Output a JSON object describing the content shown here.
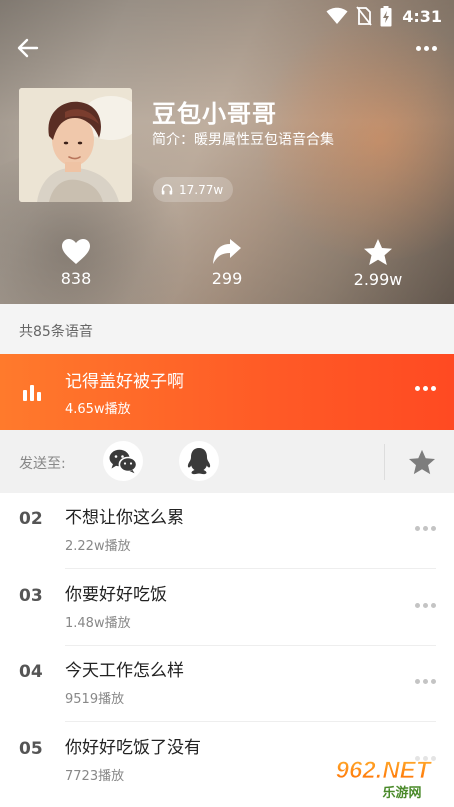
{
  "status_bar": {
    "time": "4:31",
    "icons": [
      "wifi-icon",
      "no-sim-icon",
      "battery-charging-icon"
    ]
  },
  "header": {
    "back_icon": "arrow-left-icon",
    "more_icon": "more-dots-icon",
    "title": "豆包小哥哥",
    "intro": "简介：暖男属性豆包语音合集",
    "play_count": "17.77w",
    "play_icon": "headphones-icon"
  },
  "stats": {
    "likes": "838",
    "shares": "299",
    "favorites": "2.99w"
  },
  "list": {
    "count_text": "共85条语音",
    "active": {
      "title": "记得盖好被子啊",
      "plays": "4.65w播放"
    },
    "send": {
      "label": "发送至:",
      "targets": [
        "wechat-icon",
        "qq-icon"
      ]
    },
    "items": [
      {
        "index": "02",
        "title": "不想让你这么累",
        "plays": "2.22w播放"
      },
      {
        "index": "03",
        "title": "你要好好吃饭",
        "plays": "1.48w播放"
      },
      {
        "index": "04",
        "title": "今天工作怎么样",
        "plays": "9519播放"
      },
      {
        "index": "05",
        "title": "你好好吃饭了没有",
        "plays": "7723播放"
      }
    ]
  },
  "watermark": {
    "top": "962.NET",
    "bottom": "乐游网"
  },
  "colors": {
    "accent": "#ff5a26",
    "accent_start": "#ff7a2c",
    "send_bar": "#f1f1f1",
    "count_bar": "#f4f4f4"
  }
}
